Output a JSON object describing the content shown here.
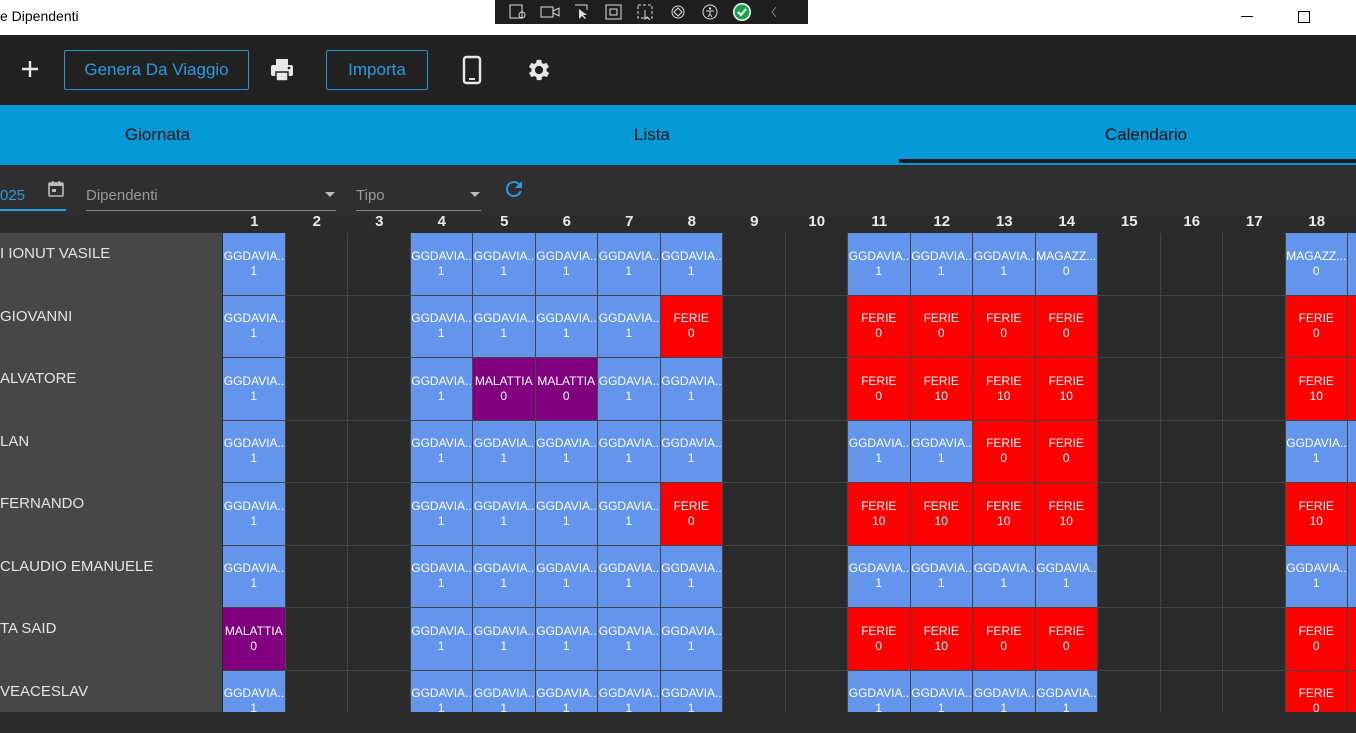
{
  "window": {
    "title": "e Dipendenti",
    "minimize_glyph": "—",
    "maximize_glyph": "☐"
  },
  "devtools": [
    "live-tree-icon",
    "video-icon",
    "select-element-icon",
    "layout-adorners-icon",
    "track-focus-icon",
    "hot-reload-icon",
    "accessibility-icon",
    "checked-icon",
    "collapse-icon"
  ],
  "toolbar": {
    "add_glyph": "+",
    "genera_label": "Genera Da Viaggio",
    "importa_label": "Importa",
    "accent": "#2196d4"
  },
  "tabs": [
    {
      "label": "Giornata",
      "selected": false
    },
    {
      "label": "Lista",
      "selected": false
    },
    {
      "label": "Calendario",
      "selected": true
    }
  ],
  "filters": {
    "date_value": "025",
    "dipendenti_placeholder": "Dipendenti",
    "tipo_placeholder": "Tipo"
  },
  "days": [
    "1",
    "2",
    "3",
    "4",
    "5",
    "6",
    "7",
    "8",
    "9",
    "10",
    "11",
    "12",
    "13",
    "14",
    "15",
    "16",
    "17",
    "18"
  ],
  "colors": {
    "GG": "#6495ed",
    "MAL": "#800080",
    "FER": "#ff0000",
    "MAG": "#6495ed"
  },
  "employees": [
    {
      "name": "I IONUT VASILE",
      "cells": [
        {
          "d": 1,
          "t": "GG",
          "l": "GGDAVIA...",
          "v": "1"
        },
        {
          "d": 4,
          "t": "GG",
          "l": "GGDAVIA...",
          "v": "1"
        },
        {
          "d": 5,
          "t": "GG",
          "l": "GGDAVIA...",
          "v": "1"
        },
        {
          "d": 6,
          "t": "GG",
          "l": "GGDAVIA...",
          "v": "1"
        },
        {
          "d": 7,
          "t": "GG",
          "l": "GGDAVIA...",
          "v": "1"
        },
        {
          "d": 8,
          "t": "GG",
          "l": "GGDAVIA...",
          "v": "1"
        },
        {
          "d": 11,
          "t": "GG",
          "l": "GGDAVIA...",
          "v": "1"
        },
        {
          "d": 12,
          "t": "GG",
          "l": "GGDAVIA...",
          "v": "1"
        },
        {
          "d": 13,
          "t": "GG",
          "l": "GGDAVIA...",
          "v": "1"
        },
        {
          "d": 14,
          "t": "MAG",
          "l": "MAGAZZ...",
          "v": "0"
        },
        {
          "d": 18,
          "t": "MAG",
          "l": "MAGAZZ...",
          "v": "0"
        },
        {
          "d": 19,
          "t": "MAG",
          "l": "M",
          "v": ""
        }
      ]
    },
    {
      "name": "GIOVANNI",
      "cells": [
        {
          "d": 1,
          "t": "GG",
          "l": "GGDAVIA...",
          "v": "1"
        },
        {
          "d": 4,
          "t": "GG",
          "l": "GGDAVIA...",
          "v": "1"
        },
        {
          "d": 5,
          "t": "GG",
          "l": "GGDAVIA...",
          "v": "1"
        },
        {
          "d": 6,
          "t": "GG",
          "l": "GGDAVIA...",
          "v": "1"
        },
        {
          "d": 7,
          "t": "GG",
          "l": "GGDAVIA...",
          "v": "1"
        },
        {
          "d": 8,
          "t": "FER",
          "l": "FERIE",
          "v": "0"
        },
        {
          "d": 11,
          "t": "FER",
          "l": "FERIE",
          "v": "0"
        },
        {
          "d": 12,
          "t": "FER",
          "l": "FERIE",
          "v": "0"
        },
        {
          "d": 13,
          "t": "FER",
          "l": "FERIE",
          "v": "0"
        },
        {
          "d": 14,
          "t": "FER",
          "l": "FERIE",
          "v": "0"
        },
        {
          "d": 18,
          "t": "FER",
          "l": "FERIE",
          "v": "0"
        },
        {
          "d": 19,
          "t": "FER",
          "l": "",
          "v": ""
        }
      ]
    },
    {
      "name": "ALVATORE",
      "cells": [
        {
          "d": 1,
          "t": "GG",
          "l": "GGDAVIA...",
          "v": "1"
        },
        {
          "d": 4,
          "t": "GG",
          "l": "GGDAVIA...",
          "v": "1"
        },
        {
          "d": 5,
          "t": "MAL",
          "l": "MALATTIA",
          "v": "0"
        },
        {
          "d": 6,
          "t": "MAL",
          "l": "MALATTIA",
          "v": "0"
        },
        {
          "d": 7,
          "t": "GG",
          "l": "GGDAVIA...",
          "v": "1"
        },
        {
          "d": 8,
          "t": "GG",
          "l": "GGDAVIA...",
          "v": "1"
        },
        {
          "d": 11,
          "t": "FER",
          "l": "FERIE",
          "v": "0"
        },
        {
          "d": 12,
          "t": "FER",
          "l": "FERIE",
          "v": "10"
        },
        {
          "d": 13,
          "t": "FER",
          "l": "FERIE",
          "v": "10"
        },
        {
          "d": 14,
          "t": "FER",
          "l": "FERIE",
          "v": "10"
        },
        {
          "d": 18,
          "t": "FER",
          "l": "FERIE",
          "v": "10"
        },
        {
          "d": 19,
          "t": "FER",
          "l": "",
          "v": ""
        }
      ]
    },
    {
      "name": "LAN",
      "cells": [
        {
          "d": 1,
          "t": "GG",
          "l": "GGDAVIA...",
          "v": "1"
        },
        {
          "d": 4,
          "t": "GG",
          "l": "GGDAVIA...",
          "v": "1"
        },
        {
          "d": 5,
          "t": "GG",
          "l": "GGDAVIA...",
          "v": "1"
        },
        {
          "d": 6,
          "t": "GG",
          "l": "GGDAVIA...",
          "v": "1"
        },
        {
          "d": 7,
          "t": "GG",
          "l": "GGDAVIA...",
          "v": "1"
        },
        {
          "d": 8,
          "t": "GG",
          "l": "GGDAVIA...",
          "v": "1"
        },
        {
          "d": 11,
          "t": "GG",
          "l": "GGDAVIA...",
          "v": "1"
        },
        {
          "d": 12,
          "t": "GG",
          "l": "GGDAVIA...",
          "v": "1"
        },
        {
          "d": 13,
          "t": "FER",
          "l": "FERIE",
          "v": "0"
        },
        {
          "d": 14,
          "t": "FER",
          "l": "FERIE",
          "v": "0"
        },
        {
          "d": 18,
          "t": "GG",
          "l": "GGDAVIA...",
          "v": "1"
        },
        {
          "d": 19,
          "t": "GG",
          "l": "G",
          "v": ""
        }
      ]
    },
    {
      "name": "FERNANDO",
      "cells": [
        {
          "d": 1,
          "t": "GG",
          "l": "GGDAVIA...",
          "v": "1"
        },
        {
          "d": 4,
          "t": "GG",
          "l": "GGDAVIA...",
          "v": "1"
        },
        {
          "d": 5,
          "t": "GG",
          "l": "GGDAVIA...",
          "v": "1"
        },
        {
          "d": 6,
          "t": "GG",
          "l": "GGDAVIA...",
          "v": "1"
        },
        {
          "d": 7,
          "t": "GG",
          "l": "GGDAVIA...",
          "v": "1"
        },
        {
          "d": 8,
          "t": "FER",
          "l": "FERIE",
          "v": "0"
        },
        {
          "d": 11,
          "t": "FER",
          "l": "FERIE",
          "v": "10"
        },
        {
          "d": 12,
          "t": "FER",
          "l": "FERIE",
          "v": "10"
        },
        {
          "d": 13,
          "t": "FER",
          "l": "FERIE",
          "v": "10"
        },
        {
          "d": 14,
          "t": "FER",
          "l": "FERIE",
          "v": "10"
        },
        {
          "d": 18,
          "t": "FER",
          "l": "FERIE",
          "v": "10"
        },
        {
          "d": 19,
          "t": "FER",
          "l": "",
          "v": ""
        }
      ]
    },
    {
      "name": "CLAUDIO EMANUELE",
      "cells": [
        {
          "d": 1,
          "t": "GG",
          "l": "GGDAVIA...",
          "v": "1"
        },
        {
          "d": 4,
          "t": "GG",
          "l": "GGDAVIA...",
          "v": "1"
        },
        {
          "d": 5,
          "t": "GG",
          "l": "GGDAVIA...",
          "v": "1"
        },
        {
          "d": 6,
          "t": "GG",
          "l": "GGDAVIA...",
          "v": "1"
        },
        {
          "d": 7,
          "t": "GG",
          "l": "GGDAVIA...",
          "v": "1"
        },
        {
          "d": 8,
          "t": "GG",
          "l": "GGDAVIA...",
          "v": "1"
        },
        {
          "d": 11,
          "t": "GG",
          "l": "GGDAVIA...",
          "v": "1"
        },
        {
          "d": 12,
          "t": "GG",
          "l": "GGDAVIA...",
          "v": "1"
        },
        {
          "d": 13,
          "t": "GG",
          "l": "GGDAVIA...",
          "v": "1"
        },
        {
          "d": 14,
          "t": "GG",
          "l": "GGDAVIA...",
          "v": "1"
        },
        {
          "d": 18,
          "t": "GG",
          "l": "GGDAVIA...",
          "v": "1"
        },
        {
          "d": 19,
          "t": "GG",
          "l": "",
          "v": ""
        }
      ]
    },
    {
      "name": "TA SAID",
      "cells": [
        {
          "d": 1,
          "t": "MAL",
          "l": "MALATTIA",
          "v": "0"
        },
        {
          "d": 4,
          "t": "GG",
          "l": "GGDAVIA...",
          "v": "1"
        },
        {
          "d": 5,
          "t": "GG",
          "l": "GGDAVIA...",
          "v": "1"
        },
        {
          "d": 6,
          "t": "GG",
          "l": "GGDAVIA...",
          "v": "1"
        },
        {
          "d": 7,
          "t": "GG",
          "l": "GGDAVIA...",
          "v": "1"
        },
        {
          "d": 8,
          "t": "GG",
          "l": "GGDAVIA...",
          "v": "1"
        },
        {
          "d": 11,
          "t": "FER",
          "l": "FERIE",
          "v": "0"
        },
        {
          "d": 12,
          "t": "FER",
          "l": "FERIE",
          "v": "10"
        },
        {
          "d": 13,
          "t": "FER",
          "l": "FERIE",
          "v": "0"
        },
        {
          "d": 14,
          "t": "FER",
          "l": "FERIE",
          "v": "0"
        },
        {
          "d": 18,
          "t": "FER",
          "l": "FERIE",
          "v": "0"
        },
        {
          "d": 19,
          "t": "FER",
          "l": "",
          "v": ""
        }
      ]
    },
    {
      "name": "VEACESLAV",
      "cells": [
        {
          "d": 1,
          "t": "GG",
          "l": "GGDAVIA...",
          "v": "1"
        },
        {
          "d": 4,
          "t": "GG",
          "l": "GGDAVIA...",
          "v": "1"
        },
        {
          "d": 5,
          "t": "GG",
          "l": "GGDAVIA...",
          "v": "1"
        },
        {
          "d": 6,
          "t": "GG",
          "l": "GGDAVIA...",
          "v": "1"
        },
        {
          "d": 7,
          "t": "GG",
          "l": "GGDAVIA...",
          "v": "1"
        },
        {
          "d": 8,
          "t": "GG",
          "l": "GGDAVIA...",
          "v": "1"
        },
        {
          "d": 11,
          "t": "GG",
          "l": "GGDAVIA...",
          "v": "1"
        },
        {
          "d": 12,
          "t": "GG",
          "l": "GGDAVIA...",
          "v": "1"
        },
        {
          "d": 13,
          "t": "GG",
          "l": "GGDAVIA...",
          "v": "1"
        },
        {
          "d": 14,
          "t": "GG",
          "l": "GGDAVIA...",
          "v": "1"
        },
        {
          "d": 18,
          "t": "FER",
          "l": "FERIE",
          "v": "0"
        },
        {
          "d": 19,
          "t": "FER",
          "l": "",
          "v": ""
        }
      ]
    }
  ]
}
